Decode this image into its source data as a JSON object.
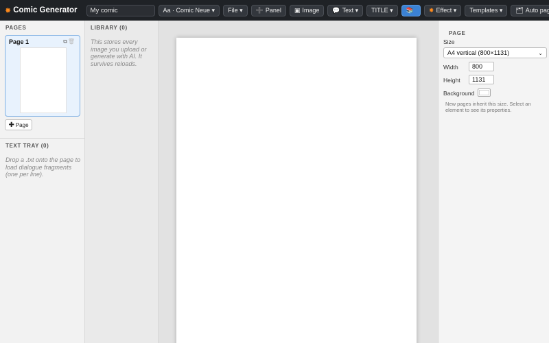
{
  "app": {
    "title": "Comic Generator",
    "icon": "burst-icon"
  },
  "toolbar": {
    "comic_name": "My comic",
    "font_button": "Aa · Comic Neue ▾",
    "file_button": "File ▾",
    "panel_button": "Panel",
    "image_button": "Image",
    "text_button": "Text ▾",
    "title_button": "TITLE ▾",
    "effect_button": "Effect ▾",
    "templates_button": "Templates ▾",
    "auto_page_button": "Auto page…",
    "accent_color": "#3b82d4"
  },
  "pages_panel": {
    "heading": "PAGES",
    "pages": [
      {
        "label": "Page 1"
      }
    ],
    "add_page_label": "Page"
  },
  "text_tray": {
    "heading": "TEXT TRAY (0)",
    "hint": "Drop a .txt onto the page to load dialogue fragments (one per line)."
  },
  "library": {
    "heading": "LIBRARY (0)",
    "hint": "This stores every image you upload or generate with AI. It survives reloads."
  },
  "properties": {
    "heading": "PAGE",
    "size_label": "Size",
    "size_value": "A4 vertical (800×1131)",
    "width_label": "Width",
    "width_value": "800",
    "height_label": "Height",
    "height_value": "1131",
    "background_label": "Background",
    "background_color": "#ffffff",
    "hint": "New pages inherit this size. Select an element to see its properties."
  }
}
